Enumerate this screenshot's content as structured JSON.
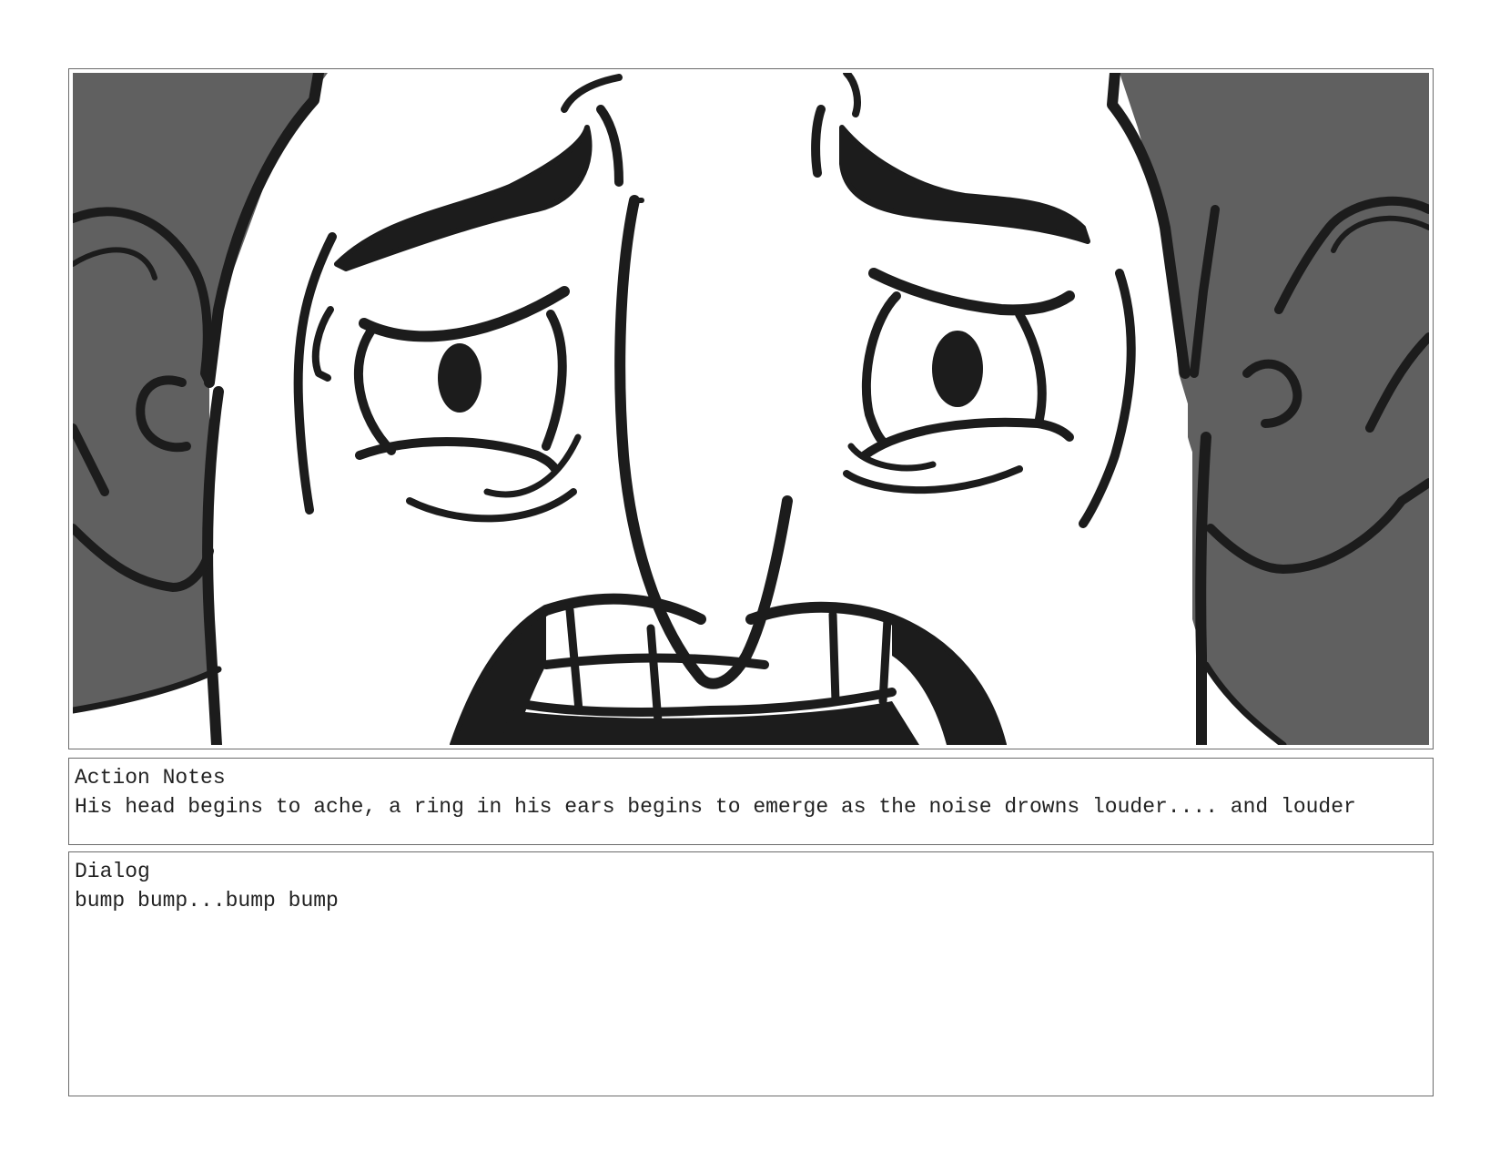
{
  "panel": {
    "image_icon": "storyboard-sketch-face-closeup",
    "colors": {
      "skin": "#606060",
      "ink": "#1c1c1c",
      "background": "#ffffff"
    }
  },
  "action_notes": {
    "label": "Action Notes",
    "text": "His head begins to ache, a ring in his ears begins to emerge as the noise drowns louder.... and louder"
  },
  "dialog": {
    "label": "Dialog",
    "text": "bump bump...bump bump"
  }
}
